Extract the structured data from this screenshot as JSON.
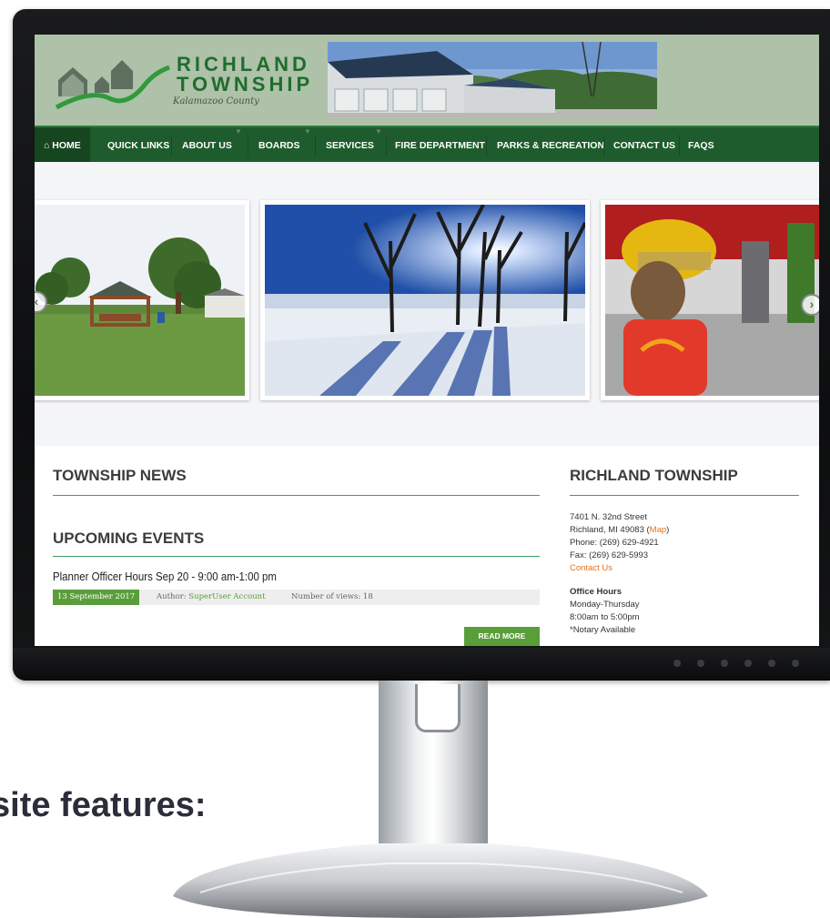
{
  "site": {
    "logo_line1": "RICHLAND",
    "logo_line2": "TOWNSHIP",
    "logo_sub": "Kalamazoo County"
  },
  "nav": {
    "items": [
      "HOME",
      "QUICK LINKS",
      "ABOUT US",
      "BOARDS",
      "SERVICES",
      "FIRE DEPARTMENT",
      "PARKS & RECREATION",
      "CONTACT US",
      "FAQS"
    ],
    "home_icon": "home-icon",
    "dropdown_icon": "chevron-down-icon"
  },
  "slider": {
    "slides": [
      "park-pavilion-photo",
      "winter-lake-sunset-photo",
      "child-firefighter-helmet-photo"
    ],
    "prev_icon": "chevron-left-icon",
    "next_icon": "chevron-right-icon"
  },
  "news": {
    "heading": "TOWNSHIP NEWS"
  },
  "events": {
    "heading": "UPCOMING EVENTS",
    "item_title": "Planner Officer Hours Sep 20 - 9:00 am-1:00 pm",
    "date": "13 September 2017",
    "author_label": "Author:",
    "author_name": "SuperUser Account",
    "views": "Number of views: 18",
    "read_more": "READ MORE"
  },
  "sidebar": {
    "heading": "RICHLAND TOWNSHIP",
    "address1": "7401 N. 32nd Street",
    "address2_prefix": "Richland, MI 49083 (",
    "map_link": "Map",
    "address2_suffix": ")",
    "phone": "Phone:  (269) 629-4921",
    "fax": "Fax:  (269) 629-5993",
    "contact_link": "Contact Us",
    "hours_title": "Office Hours",
    "hours_days": "Monday-Thursday",
    "hours_time": "8:00am to 5:00pm",
    "hours_note": "*Notary Available"
  },
  "caption": "site features:",
  "colors": {
    "header_bg": "#aec1a9",
    "nav_bg": "#1f5c2d",
    "accent_green": "#5a9e3a",
    "link_orange": "#e3741f"
  }
}
